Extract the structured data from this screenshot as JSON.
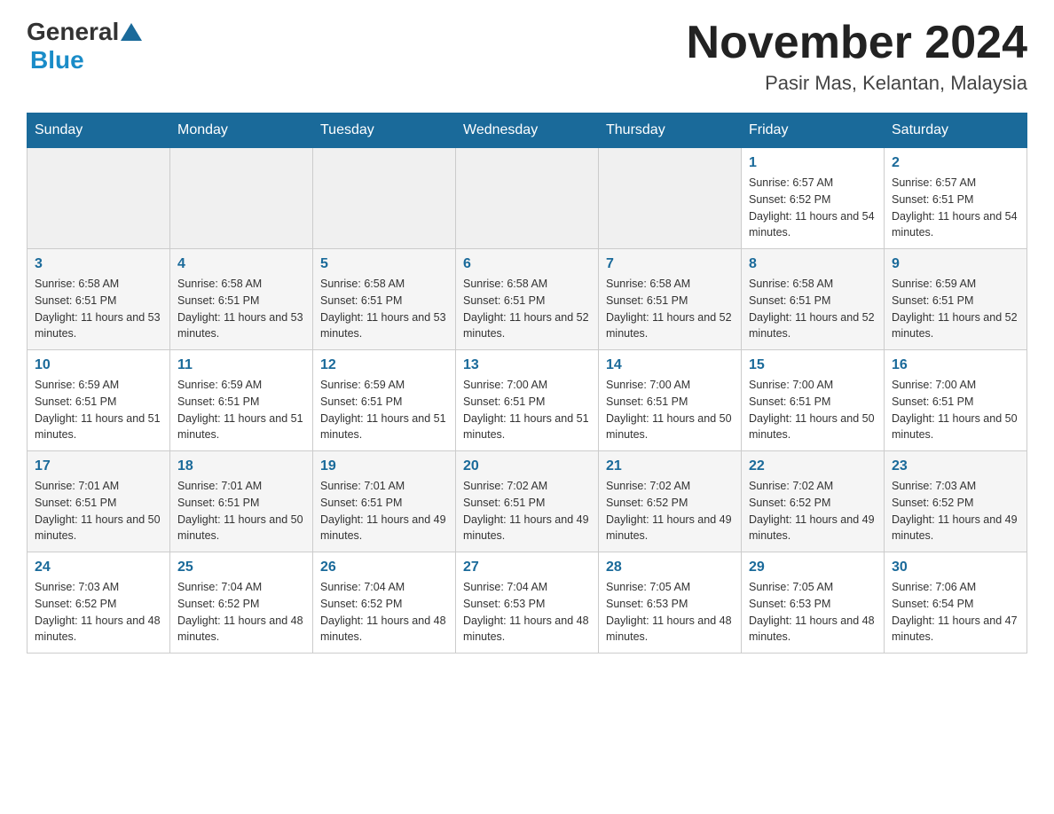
{
  "header": {
    "logo_general": "General",
    "logo_blue": "Blue",
    "month_title": "November 2024",
    "location": "Pasir Mas, Kelantan, Malaysia"
  },
  "days_of_week": [
    "Sunday",
    "Monday",
    "Tuesday",
    "Wednesday",
    "Thursday",
    "Friday",
    "Saturday"
  ],
  "weeks": [
    [
      {
        "day": "",
        "sunrise": "",
        "sunset": "",
        "daylight": "",
        "empty": true
      },
      {
        "day": "",
        "sunrise": "",
        "sunset": "",
        "daylight": "",
        "empty": true
      },
      {
        "day": "",
        "sunrise": "",
        "sunset": "",
        "daylight": "",
        "empty": true
      },
      {
        "day": "",
        "sunrise": "",
        "sunset": "",
        "daylight": "",
        "empty": true
      },
      {
        "day": "",
        "sunrise": "",
        "sunset": "",
        "daylight": "",
        "empty": true
      },
      {
        "day": "1",
        "sunrise": "Sunrise: 6:57 AM",
        "sunset": "Sunset: 6:52 PM",
        "daylight": "Daylight: 11 hours and 54 minutes.",
        "empty": false
      },
      {
        "day": "2",
        "sunrise": "Sunrise: 6:57 AM",
        "sunset": "Sunset: 6:51 PM",
        "daylight": "Daylight: 11 hours and 54 minutes.",
        "empty": false
      }
    ],
    [
      {
        "day": "3",
        "sunrise": "Sunrise: 6:58 AM",
        "sunset": "Sunset: 6:51 PM",
        "daylight": "Daylight: 11 hours and 53 minutes.",
        "empty": false
      },
      {
        "day": "4",
        "sunrise": "Sunrise: 6:58 AM",
        "sunset": "Sunset: 6:51 PM",
        "daylight": "Daylight: 11 hours and 53 minutes.",
        "empty": false
      },
      {
        "day": "5",
        "sunrise": "Sunrise: 6:58 AM",
        "sunset": "Sunset: 6:51 PM",
        "daylight": "Daylight: 11 hours and 53 minutes.",
        "empty": false
      },
      {
        "day": "6",
        "sunrise": "Sunrise: 6:58 AM",
        "sunset": "Sunset: 6:51 PM",
        "daylight": "Daylight: 11 hours and 52 minutes.",
        "empty": false
      },
      {
        "day": "7",
        "sunrise": "Sunrise: 6:58 AM",
        "sunset": "Sunset: 6:51 PM",
        "daylight": "Daylight: 11 hours and 52 minutes.",
        "empty": false
      },
      {
        "day": "8",
        "sunrise": "Sunrise: 6:58 AM",
        "sunset": "Sunset: 6:51 PM",
        "daylight": "Daylight: 11 hours and 52 minutes.",
        "empty": false
      },
      {
        "day": "9",
        "sunrise": "Sunrise: 6:59 AM",
        "sunset": "Sunset: 6:51 PM",
        "daylight": "Daylight: 11 hours and 52 minutes.",
        "empty": false
      }
    ],
    [
      {
        "day": "10",
        "sunrise": "Sunrise: 6:59 AM",
        "sunset": "Sunset: 6:51 PM",
        "daylight": "Daylight: 11 hours and 51 minutes.",
        "empty": false
      },
      {
        "day": "11",
        "sunrise": "Sunrise: 6:59 AM",
        "sunset": "Sunset: 6:51 PM",
        "daylight": "Daylight: 11 hours and 51 minutes.",
        "empty": false
      },
      {
        "day": "12",
        "sunrise": "Sunrise: 6:59 AM",
        "sunset": "Sunset: 6:51 PM",
        "daylight": "Daylight: 11 hours and 51 minutes.",
        "empty": false
      },
      {
        "day": "13",
        "sunrise": "Sunrise: 7:00 AM",
        "sunset": "Sunset: 6:51 PM",
        "daylight": "Daylight: 11 hours and 51 minutes.",
        "empty": false
      },
      {
        "day": "14",
        "sunrise": "Sunrise: 7:00 AM",
        "sunset": "Sunset: 6:51 PM",
        "daylight": "Daylight: 11 hours and 50 minutes.",
        "empty": false
      },
      {
        "day": "15",
        "sunrise": "Sunrise: 7:00 AM",
        "sunset": "Sunset: 6:51 PM",
        "daylight": "Daylight: 11 hours and 50 minutes.",
        "empty": false
      },
      {
        "day": "16",
        "sunrise": "Sunrise: 7:00 AM",
        "sunset": "Sunset: 6:51 PM",
        "daylight": "Daylight: 11 hours and 50 minutes.",
        "empty": false
      }
    ],
    [
      {
        "day": "17",
        "sunrise": "Sunrise: 7:01 AM",
        "sunset": "Sunset: 6:51 PM",
        "daylight": "Daylight: 11 hours and 50 minutes.",
        "empty": false
      },
      {
        "day": "18",
        "sunrise": "Sunrise: 7:01 AM",
        "sunset": "Sunset: 6:51 PM",
        "daylight": "Daylight: 11 hours and 50 minutes.",
        "empty": false
      },
      {
        "day": "19",
        "sunrise": "Sunrise: 7:01 AM",
        "sunset": "Sunset: 6:51 PM",
        "daylight": "Daylight: 11 hours and 49 minutes.",
        "empty": false
      },
      {
        "day": "20",
        "sunrise": "Sunrise: 7:02 AM",
        "sunset": "Sunset: 6:51 PM",
        "daylight": "Daylight: 11 hours and 49 minutes.",
        "empty": false
      },
      {
        "day": "21",
        "sunrise": "Sunrise: 7:02 AM",
        "sunset": "Sunset: 6:52 PM",
        "daylight": "Daylight: 11 hours and 49 minutes.",
        "empty": false
      },
      {
        "day": "22",
        "sunrise": "Sunrise: 7:02 AM",
        "sunset": "Sunset: 6:52 PM",
        "daylight": "Daylight: 11 hours and 49 minutes.",
        "empty": false
      },
      {
        "day": "23",
        "sunrise": "Sunrise: 7:03 AM",
        "sunset": "Sunset: 6:52 PM",
        "daylight": "Daylight: 11 hours and 49 minutes.",
        "empty": false
      }
    ],
    [
      {
        "day": "24",
        "sunrise": "Sunrise: 7:03 AM",
        "sunset": "Sunset: 6:52 PM",
        "daylight": "Daylight: 11 hours and 48 minutes.",
        "empty": false
      },
      {
        "day": "25",
        "sunrise": "Sunrise: 7:04 AM",
        "sunset": "Sunset: 6:52 PM",
        "daylight": "Daylight: 11 hours and 48 minutes.",
        "empty": false
      },
      {
        "day": "26",
        "sunrise": "Sunrise: 7:04 AM",
        "sunset": "Sunset: 6:52 PM",
        "daylight": "Daylight: 11 hours and 48 minutes.",
        "empty": false
      },
      {
        "day": "27",
        "sunrise": "Sunrise: 7:04 AM",
        "sunset": "Sunset: 6:53 PM",
        "daylight": "Daylight: 11 hours and 48 minutes.",
        "empty": false
      },
      {
        "day": "28",
        "sunrise": "Sunrise: 7:05 AM",
        "sunset": "Sunset: 6:53 PM",
        "daylight": "Daylight: 11 hours and 48 minutes.",
        "empty": false
      },
      {
        "day": "29",
        "sunrise": "Sunrise: 7:05 AM",
        "sunset": "Sunset: 6:53 PM",
        "daylight": "Daylight: 11 hours and 48 minutes.",
        "empty": false
      },
      {
        "day": "30",
        "sunrise": "Sunrise: 7:06 AM",
        "sunset": "Sunset: 6:54 PM",
        "daylight": "Daylight: 11 hours and 47 minutes.",
        "empty": false
      }
    ]
  ]
}
